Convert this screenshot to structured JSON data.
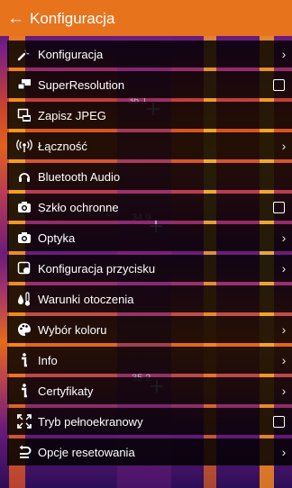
{
  "header": {
    "back_icon": "arrow-left-icon",
    "title": "Konfiguracja"
  },
  "colors": {
    "header": "#e7741d",
    "row_bg": "#000000"
  },
  "menu": [
    {
      "label": "Konfiguracja",
      "icon": "wrench-icon",
      "control": "chevron"
    },
    {
      "label": "SuperResolution",
      "icon": "superresolution-icon",
      "control": "checkbox",
      "checked": false
    },
    {
      "label": "Zapisz JPEG",
      "icon": "jpeg-save-icon",
      "control": "none"
    },
    {
      "label": "Łączność",
      "icon": "wireless-icon",
      "control": "chevron"
    },
    {
      "label": "Bluetooth Audio",
      "icon": "headphones-icon",
      "control": "none"
    },
    {
      "label": "Szkło ochronne",
      "icon": "camera-icon",
      "control": "checkbox",
      "checked": false
    },
    {
      "label": "Optyka",
      "icon": "camera-icon",
      "control": "chevron"
    },
    {
      "label": "Konfiguracja przycisku",
      "icon": "button-config-icon",
      "control": "chevron"
    },
    {
      "label": "Warunki otoczenia",
      "icon": "thermometer-drop-icon",
      "control": "none"
    },
    {
      "label": "Wybór koloru",
      "icon": "palette-icon",
      "control": "chevron"
    },
    {
      "label": "Info",
      "icon": "info-icon",
      "control": "chevron"
    },
    {
      "label": "Certyfikaty",
      "icon": "info-icon",
      "control": "chevron"
    },
    {
      "label": "Tryb pełnoekranowy",
      "icon": "fullscreen-icon",
      "control": "checkbox",
      "checked": false
    },
    {
      "label": "Opcje resetowania",
      "icon": "reset-icon",
      "control": "chevron"
    }
  ],
  "readings": [
    "36.1",
    "34.9",
    "35.2"
  ],
  "chevron_char": "›"
}
